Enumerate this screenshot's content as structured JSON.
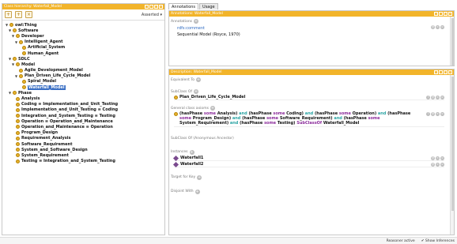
{
  "left_panel": {
    "title": "Class hierarchy: Waterfall_Model",
    "view_mode": "Asserted",
    "tree": [
      {
        "label": "owl:Thing"
      },
      {
        "label": "Software"
      },
      {
        "label": "Developer"
      },
      {
        "label": "Intelligent_Agent"
      },
      {
        "label": "Artificial_System"
      },
      {
        "label": "Human_Agent"
      },
      {
        "label": "SDLC"
      },
      {
        "label": "Model"
      },
      {
        "label": "Agile_Development_Model"
      },
      {
        "label": "Plan_Driven_Life_Cycle_Model"
      },
      {
        "label": "Spiral_Model"
      },
      {
        "label": "Waterfall_Model"
      },
      {
        "label": "Phase"
      },
      {
        "label": "Analysis"
      },
      {
        "label": "Coding ≡ Implementation_and_Unit_Testing"
      },
      {
        "label": "Implementation_and_Unit_Testing ≡ Coding"
      },
      {
        "label": "Integration_and_System_Testing ≡ Testing"
      },
      {
        "label": "Operation ≡ Operation_and_Maintenance"
      },
      {
        "label": "Operation_and_Maintenance ≡ Operation"
      },
      {
        "label": "Program_Design"
      },
      {
        "label": "Requirement_Analysis"
      },
      {
        "label": "Software_Requirement"
      },
      {
        "label": "System_and_Software_Design"
      },
      {
        "label": "System_Requirement"
      },
      {
        "label": "Testing ≡ Integration_and_System_Testing"
      }
    ]
  },
  "tabs": [
    {
      "label": "Annotations"
    },
    {
      "label": "Usage"
    }
  ],
  "annotations_panel": {
    "title": "Annotations: Waterfall_Model",
    "section": "Annotations",
    "property": "rdfs:comment",
    "value": "Sequential Model (Royce, 1970)"
  },
  "description_panel": {
    "title": "Description: Waterfall_Model",
    "sections": {
      "equivalent": "Equivalent To",
      "subclass": "SubClass Of",
      "general": "General class axioms",
      "anon": "SubClass Of (Anonymous Ancestor)",
      "instances": "Instances",
      "target": "Target for Key",
      "disjoint": "Disjoint With"
    },
    "subclass_value": "Plan_Driven_Life_Cycle_Model",
    "axiom": {
      "p1": "(hasPhase",
      "s1": "some",
      "c1": "Analysis)",
      "and": "and",
      "c2": "Coding)",
      "c3": "Operation)",
      "c4": "Program_Design)",
      "c5": "Software_Requirement)",
      "c6": "System_Requirement)",
      "c7": "Testing)",
      "sub": "SubClassOf",
      "target": "Waterfall_Model"
    },
    "instances": [
      "Waterfall1",
      "Waterfall2"
    ]
  },
  "status": {
    "reasoner": "Reasoner active",
    "show_inferences": "Show Inferences"
  },
  "colors": {
    "accent": "#f2b42a",
    "selection": "#3a6fc4"
  }
}
